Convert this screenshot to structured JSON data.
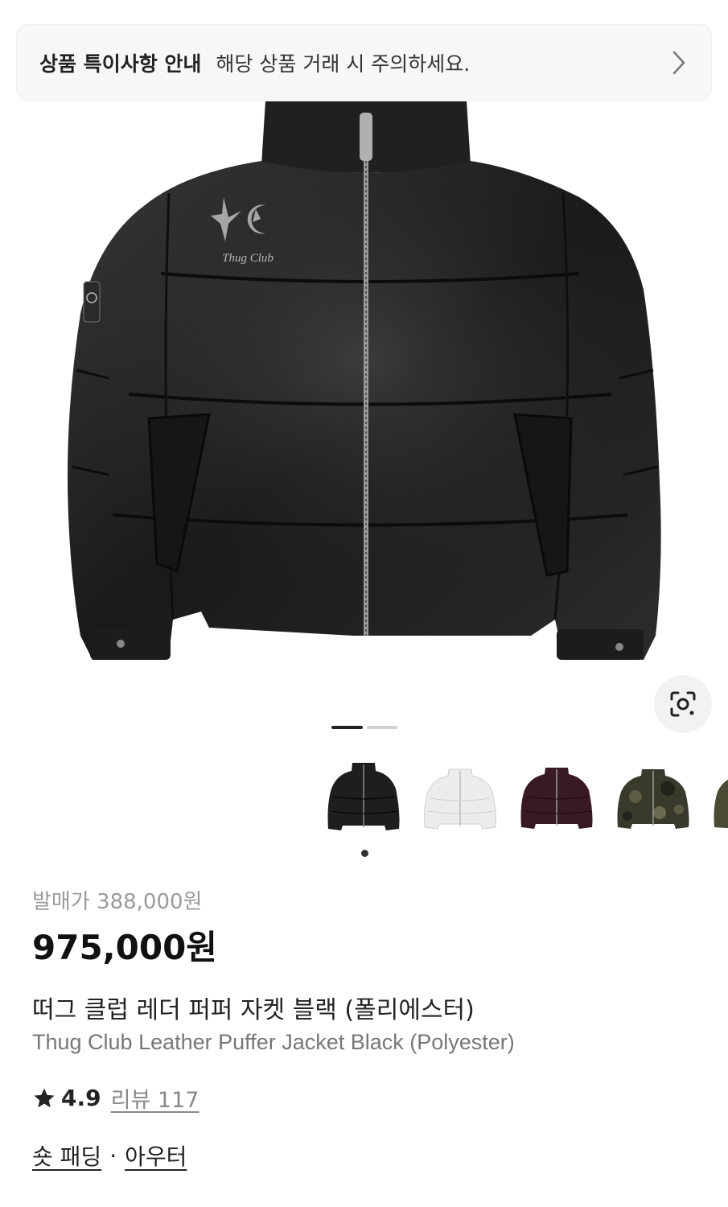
{
  "notice": {
    "title": "상품 특이사항 안내",
    "text": "해당 상품 거래 시 주의하세요."
  },
  "hero": {
    "logo_text": "Thug Club",
    "image_count": 2,
    "current_image": 1
  },
  "thumbnails": [
    {
      "color_name": "black",
      "color": "#1e1e1e"
    },
    {
      "color_name": "white",
      "color": "#ececea"
    },
    {
      "color_name": "burgundy",
      "color": "#3a1a22"
    },
    {
      "color_name": "camo",
      "color": "#3a3a2c"
    },
    {
      "color_name": "partial",
      "color": "#4a4a34"
    }
  ],
  "product": {
    "release_price": "발매가 388,000원",
    "price": "975,000원",
    "name_ko": "떠그 클럽 레더 퍼퍼 자켓 블랙 (폴리에스터)",
    "name_en": "Thug Club Leather Puffer Jacket Black (Polyester)",
    "rating": "4.9",
    "review_label": "리뷰 117",
    "categories": [
      "숏 패딩",
      "아우터"
    ],
    "category_separator": "·"
  }
}
